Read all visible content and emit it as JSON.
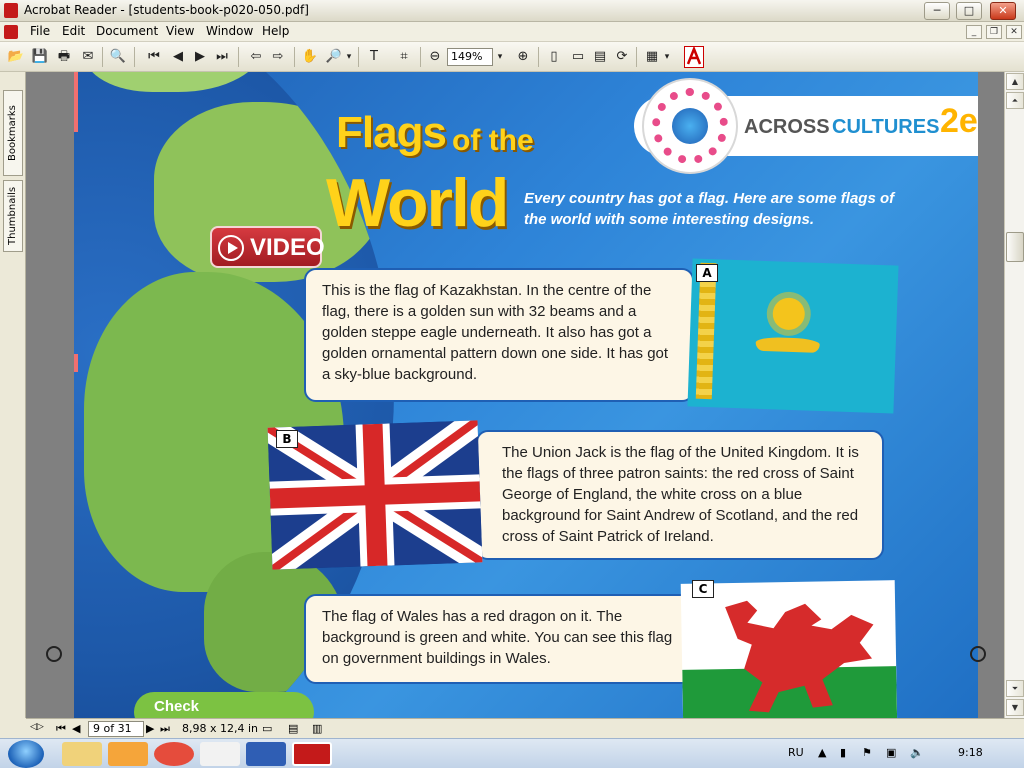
{
  "window": {
    "title": "Acrobat Reader - [students-book-p020-050.pdf]",
    "minimize": "─",
    "maximize": "□",
    "close": "✕"
  },
  "menu": [
    "File",
    "Edit",
    "Document",
    "View",
    "Window",
    "Help"
  ],
  "toolbar": {
    "zoom_value": "149%"
  },
  "sidebar": {
    "tabs": [
      "Bookmarks",
      "Thumbnails"
    ]
  },
  "page": {
    "title_line1": "Flags",
    "title_of_the": "of the",
    "title_line2": "World",
    "intro": "Every country has got a flag. Here are some flags of the world with some interesting designs.",
    "video_label": "VIDEO",
    "banner_across": "ACROSS",
    "banner_cultures": "CULTURES",
    "banner_num": "2e",
    "boxes": [
      {
        "tag": "A",
        "text": "This is the flag of Kazakhstan. In the centre of the flag, there is a golden sun with 32 beams and a golden steppe eagle underneath. It also has got a golden ornamental pattern down one side. It has got a sky-blue background."
      },
      {
        "tag": "B",
        "text": "The Union Jack is the flag of the United Kingdom. It is the flags of three patron saints: the red cross of Saint George of England, the white cross on a blue background for Saint Andrew of Scotland, and the red cross of Saint Patrick of Ireland."
      },
      {
        "tag": "C",
        "text": "The flag of Wales has a red dragon on it. The background is green and white. You can see this flag on government buildings in Wales."
      }
    ],
    "check_label": "Check"
  },
  "status": {
    "page_of": "9 of 31",
    "page_size": "8,98 x 12,4 in"
  },
  "taskbar": {
    "lang": "RU",
    "time": "9:18"
  },
  "colors": {
    "title_yellow": "#ffd21a",
    "video_red": "#b8232a",
    "banner_blue": "#1f5fb4",
    "box_bg": "#fdf6e6"
  }
}
